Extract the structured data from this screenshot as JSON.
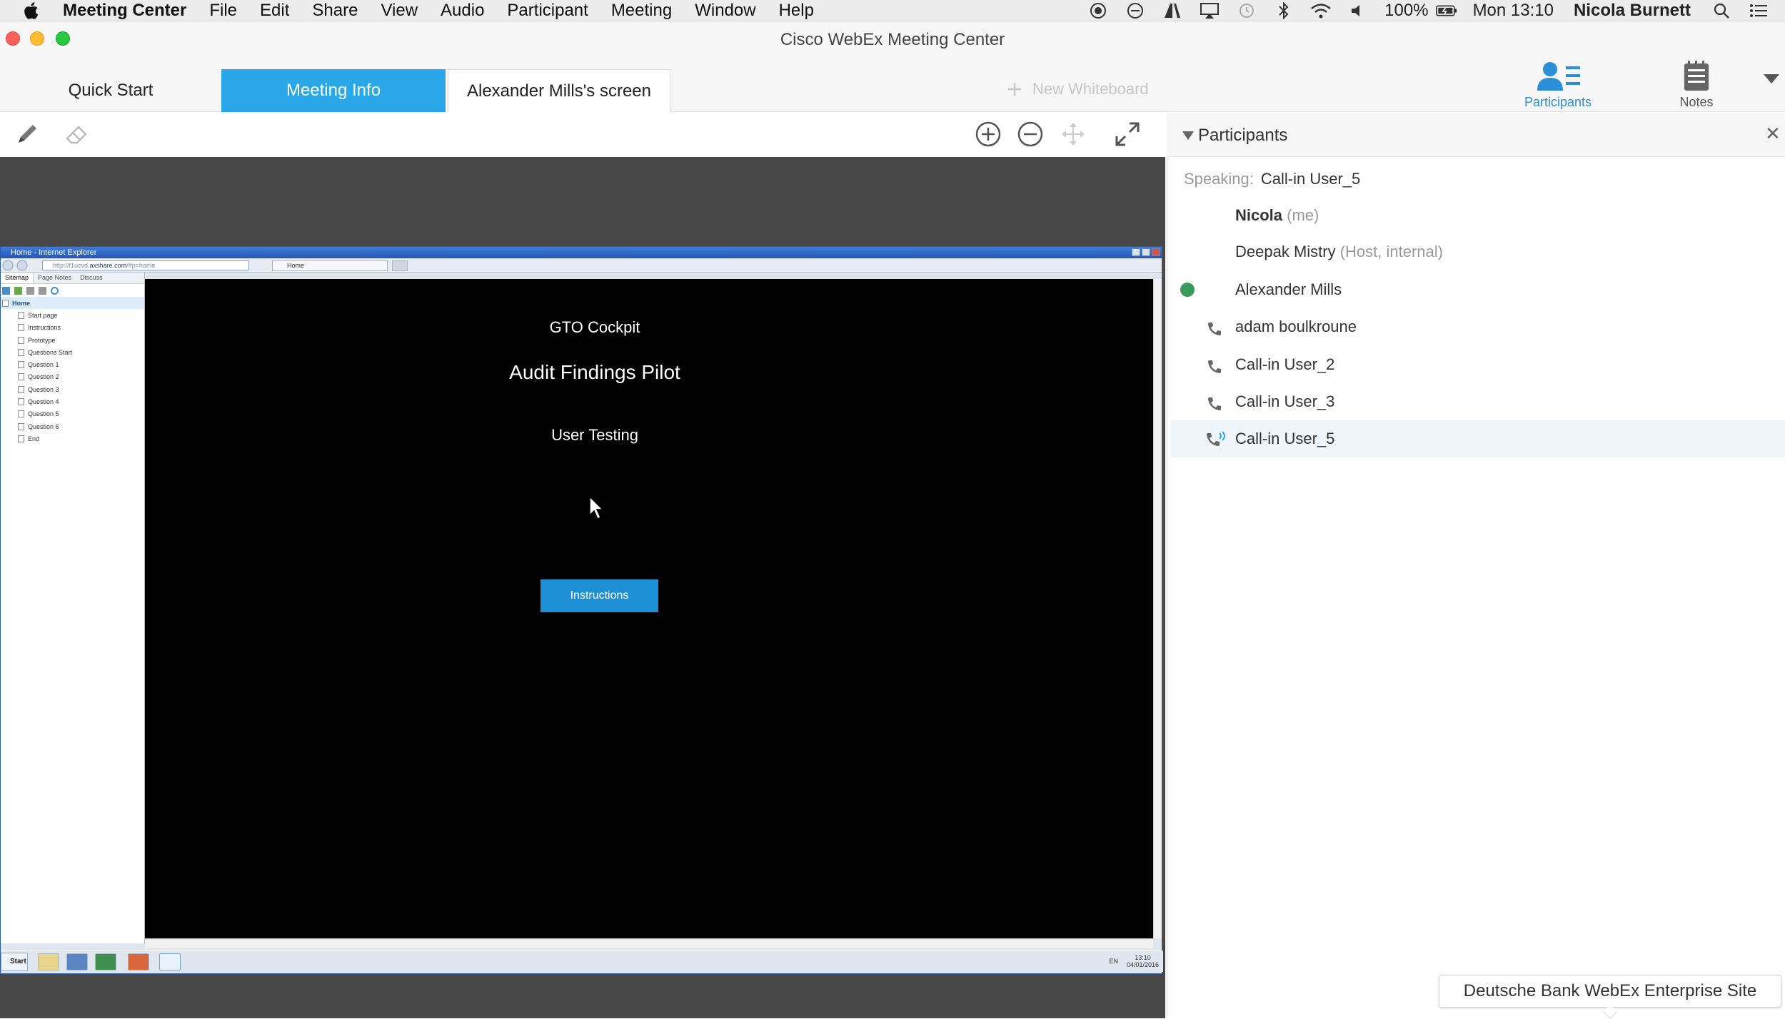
{
  "menubar": {
    "app_name": "Meeting Center",
    "items": [
      "File",
      "Edit",
      "Share",
      "View",
      "Audio",
      "Participant",
      "Meeting",
      "Window",
      "Help"
    ],
    "battery": "100%",
    "clock": "Mon 13:10",
    "user": "Nicola Burnett"
  },
  "window": {
    "title": "Cisco WebEx Meeting Center"
  },
  "tabs": [
    {
      "label": "Quick Start"
    },
    {
      "label": "Meeting Info"
    },
    {
      "label": "Alexander Mills's screen"
    }
  ],
  "new_whiteboard": "New Whiteboard",
  "panel_buttons": {
    "participants": "Participants",
    "notes": "Notes"
  },
  "shared_screen": {
    "ie_title": "Home - Internet Explorer",
    "url_prefix": "http://",
    "url_host": "axshare.com",
    "url_path": "/#p=home",
    "url_masked": "f1ucvd.",
    "tab_label": "Home",
    "sitemap_tabs": [
      "Sitemap",
      "Page Notes",
      "Discuss"
    ],
    "sitemap_home": "Home",
    "sitemap_items": [
      "Start page",
      "Instructions",
      "Prototype",
      "Questions Start",
      "Question 1",
      "Question 2",
      "Question 3",
      "Question 4",
      "Question 5",
      "Question 6",
      "End"
    ],
    "heading_small": "GTO Cockpit",
    "heading_large": "Audit Findings Pilot",
    "subheading": "User Testing",
    "button": "Instructions",
    "taskbar_start": "Start",
    "tray_lang": "EN",
    "tray_time": "13:10",
    "tray_date": "04/01/2016"
  },
  "participants_panel": {
    "title": "Participants",
    "speaking_label": "Speaking:",
    "speaking_name": "Call-in User_5",
    "list": [
      {
        "name": "Nicola",
        "sub": "(me)",
        "icon": "none"
      },
      {
        "name": "Deepak Mistry",
        "sub": "(Host, internal)",
        "icon": "none"
      },
      {
        "name": "Alexander Mills",
        "sub": "",
        "icon": "presenter-ball-icon"
      },
      {
        "name": "adam boulkroune",
        "sub": "",
        "icon": "phone-icon"
      },
      {
        "name": "Call-in User_2",
        "sub": "",
        "icon": "phone-icon"
      },
      {
        "name": "Call-in User_3",
        "sub": "",
        "icon": "phone-icon"
      },
      {
        "name": "Call-in User_5",
        "sub": "",
        "icon": "phone-speaking-icon"
      }
    ]
  },
  "enterprise_tooltip": "Deutsche Bank WebEx Enterprise Site",
  "colors": {
    "accent": "#2aa7e8",
    "participants_blue": "#2a8fd6",
    "instructions_button": "#1d8fd4"
  }
}
